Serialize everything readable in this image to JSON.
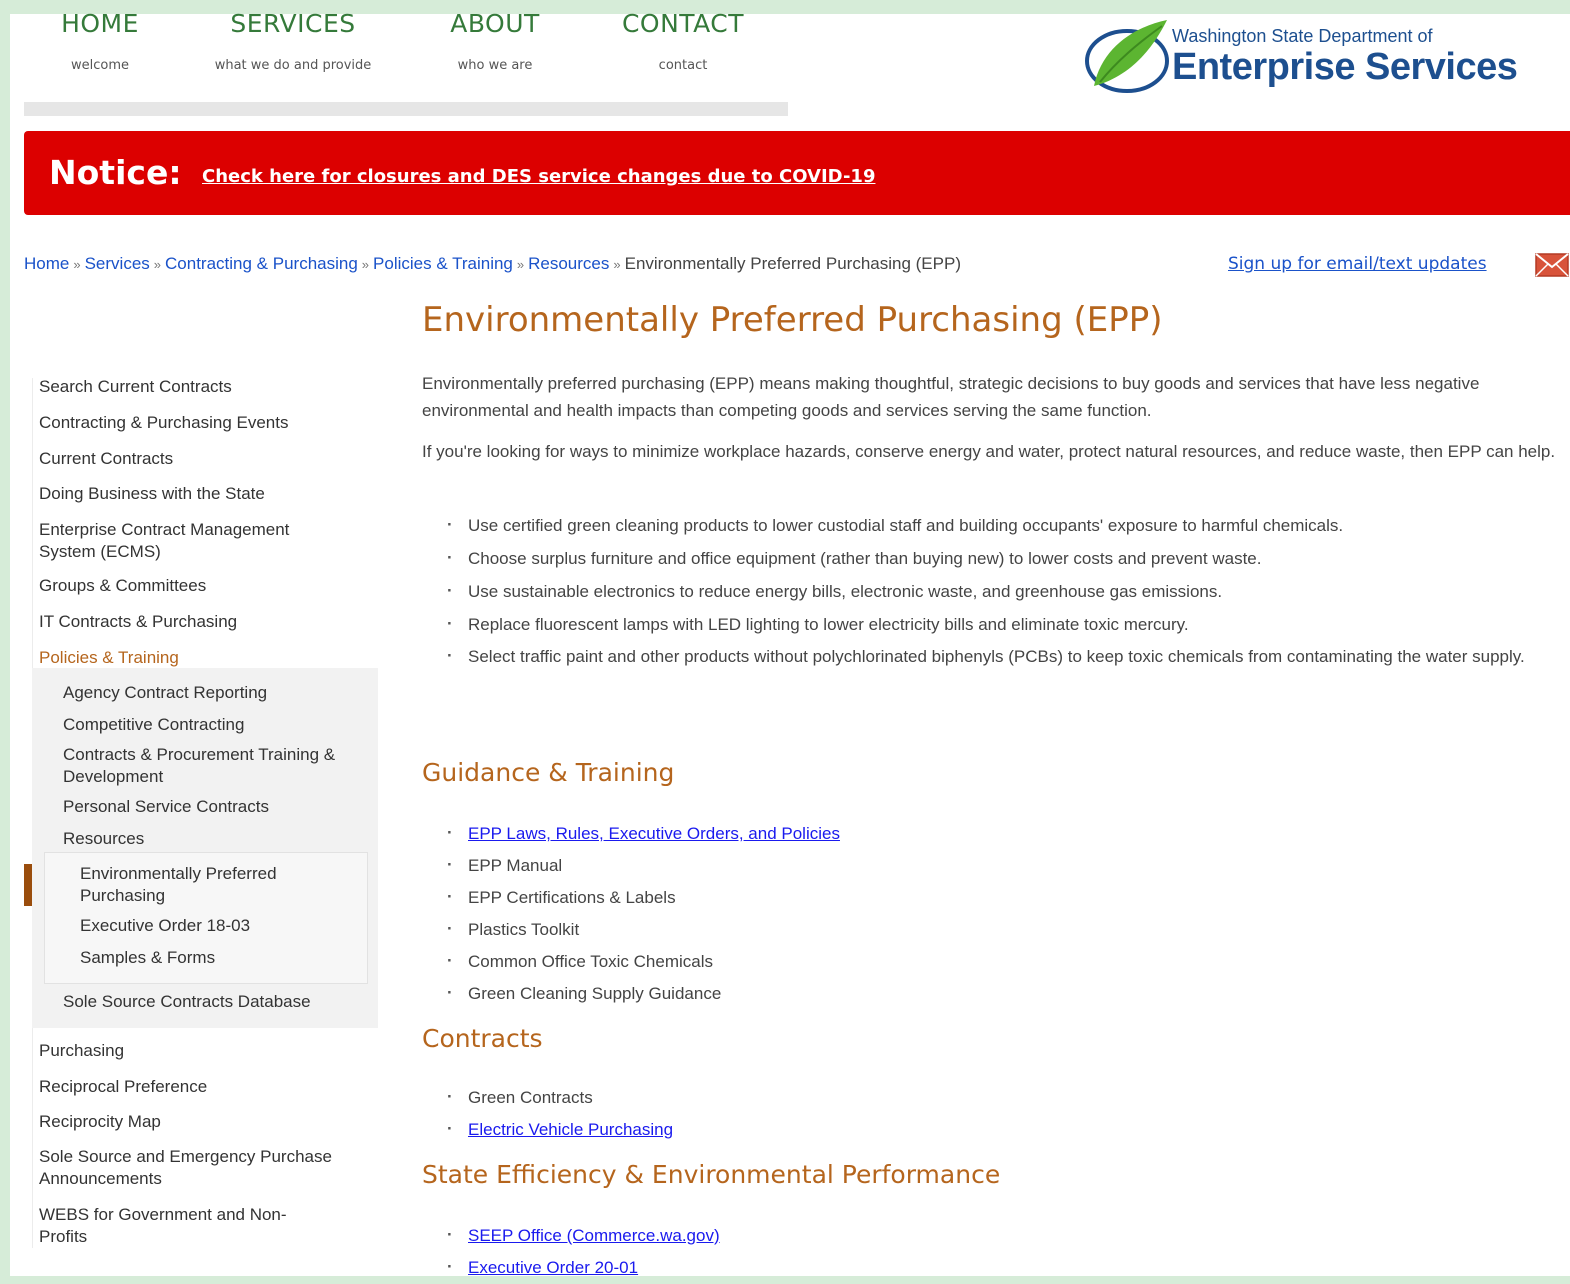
{
  "nav": [
    {
      "label": "HOME",
      "sub": "welcome"
    },
    {
      "label": "SERVICES",
      "sub": "what we do and provide"
    },
    {
      "label": "ABOUT",
      "sub": "who we are"
    },
    {
      "label": "CONTACT",
      "sub": "contact"
    }
  ],
  "logo": {
    "line1": "Washington State Department of",
    "line2": "Enterprise Services"
  },
  "notice": {
    "label": "Notice:",
    "link": "Check here for closures and DES service changes due to COVID-19",
    "color": "#dc0000"
  },
  "breadcrumb": {
    "items": [
      "Home",
      "Services",
      "Contracting & Purchasing",
      "Policies & Training",
      "Resources"
    ],
    "current": "Environmentally Preferred Purchasing (EPP)",
    "sep": "»"
  },
  "signup": "Sign up for email/text updates",
  "title": "Environmentally Preferred Purchasing (EPP)",
  "sidebar": {
    "top": [
      "Search Current Contracts",
      "Contracting & Purchasing Events",
      "Current Contracts",
      "Doing Business with the State",
      "Enterprise Contract Management System (ECMS)",
      "Groups & Committees",
      "IT Contracts & Purchasing",
      "Policies & Training"
    ],
    "sub": [
      "Agency Contract Reporting",
      "Competitive Contracting",
      "Contracts & Procurement Training & Development",
      "Personal Service Contracts",
      "Resources"
    ],
    "sub3": [
      "Environmentally Preferred Purchasing",
      "Executive Order 18-03",
      "Samples & Forms"
    ],
    "sub_after": "Sole Source Contracts Database",
    "bottom": [
      "Purchasing",
      "Reciprocal Preference",
      "Reciprocity Map",
      "Sole Source and Emergency Purchase Announcements",
      "WEBS for Government and Non-Profits"
    ]
  },
  "content": {
    "p1": "Environmentally preferred purchasing (EPP) means making thoughtful, strategic decisions to buy goods and services that have less negative environmental and health impacts than competing goods and services serving the same function.",
    "p2": "If you're looking for ways to minimize workplace hazards, conserve energy and water, protect natural resources, and reduce waste, then EPP can help.",
    "bullets": [
      "Use certified green cleaning products to lower custodial staff and building occupants' exposure to harmful chemicals.",
      "Choose surplus furniture and office equipment (rather than buying new) to lower costs and prevent waste.",
      "Use sustainable electronics to reduce energy bills, electronic waste, and greenhouse gas emissions.",
      "Replace fluorescent lamps with LED lighting to lower electricity bills and eliminate toxic mercury.",
      "Select traffic paint and other products without polychlorinated biphenyls (PCBs) to keep toxic chemicals from contaminating the water supply."
    ],
    "guidance": {
      "heading": "Guidance & Training",
      "items": [
        "EPP Laws, Rules, Executive Orders, and Policies",
        "EPP Manual",
        "EPP Certifications & Labels",
        "Plastics Toolkit",
        "Common Office Toxic Chemicals",
        "Green Cleaning Supply Guidance"
      ]
    },
    "contracts": {
      "heading": "Contracts",
      "items": [
        "Green Contracts",
        "Electric Vehicle Purchasing"
      ]
    },
    "state": {
      "heading": "State Efficiency & Environmental Performance",
      "items": [
        "SEEP Office (Commerce.wa.gov)",
        "Executive Order 20-01"
      ]
    }
  }
}
